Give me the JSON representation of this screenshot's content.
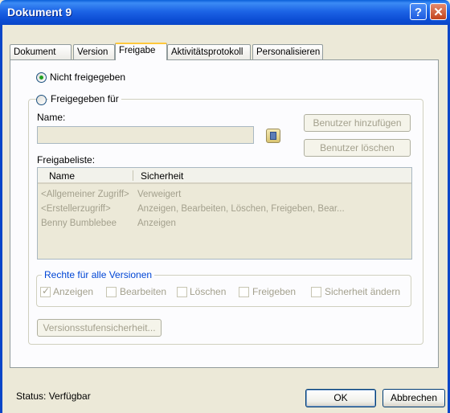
{
  "window": {
    "title": "Dokument 9",
    "help_label": "?",
    "close_label": "✕"
  },
  "tabs": [
    {
      "label": "Dokument"
    },
    {
      "label": "Version"
    },
    {
      "label": "Freigabe"
    },
    {
      "label": "Aktivitätsprotokoll"
    },
    {
      "label": "Personalisieren"
    }
  ],
  "active_tab": "Freigabe",
  "sharing": {
    "not_shared_label": "Nicht freigegeben",
    "shared_for_label": "Freigegeben für",
    "selected": "Nicht freigegeben",
    "name_label": "Name:",
    "name_value": "",
    "add_user_label": "Benutzer hinzufügen",
    "remove_user_label": "Benutzer löschen",
    "list_label": "Freigabeliste:",
    "columns": [
      "Name",
      "Sicherheit"
    ],
    "rows": [
      {
        "name": "<Allgemeiner Zugriff>",
        "security": "Verweigert"
      },
      {
        "name": "<Erstellerzugriff>",
        "security": "Anzeigen, Bearbeiten, Löschen, Freigeben, Bear..."
      },
      {
        "name": "Benny Bumblebee",
        "security": "Anzeigen"
      }
    ],
    "rights_legend": "Rechte für alle Versionen",
    "rights": [
      {
        "label": "Anzeigen",
        "checked": true
      },
      {
        "label": "Bearbeiten",
        "checked": false
      },
      {
        "label": "Löschen",
        "checked": false
      },
      {
        "label": "Freigeben",
        "checked": false
      },
      {
        "label": "Sicherheit ändern",
        "checked": false
      }
    ],
    "version_security_label": "Versionsstufensicherheit..."
  },
  "footer": {
    "status": "Status: Verfügbar",
    "ok_label": "OK",
    "cancel_label": "Abbrechen"
  }
}
